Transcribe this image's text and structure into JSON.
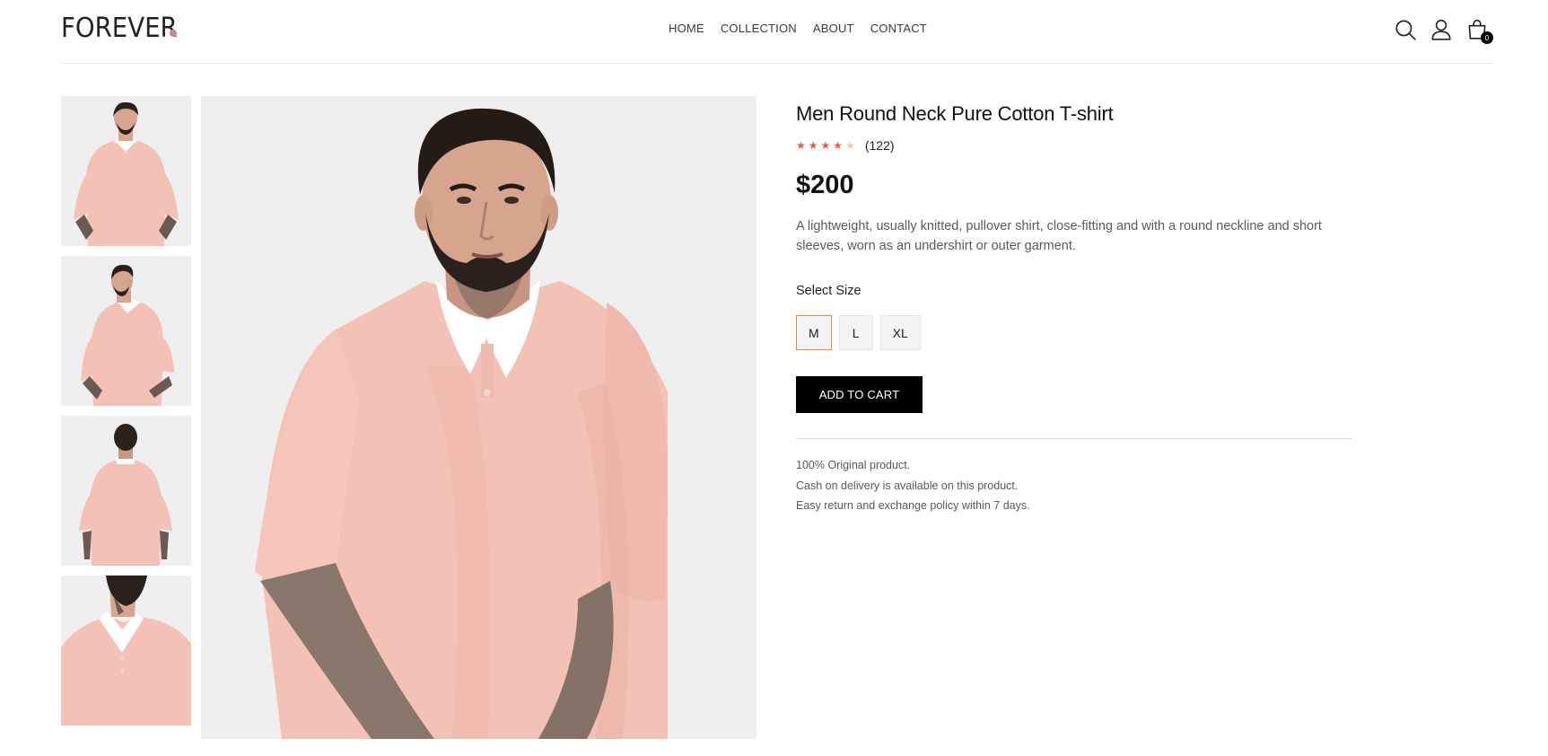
{
  "header": {
    "logo": "FOREVER",
    "nav": [
      "HOME",
      "COLLECTION",
      "ABOUT",
      "CONTACT"
    ],
    "cart_count": "0",
    "icons": [
      "search-icon",
      "profile-icon",
      "cart-icon"
    ]
  },
  "product": {
    "title": "Men Round Neck Pure Cotton T-shirt",
    "rating_stars": 4,
    "rating_max": 5,
    "rating_count": "(122)",
    "price": "$200",
    "description": "A lightweight, usually knitted, pullover shirt, close-fitting and with a round neckline and short sleeves, worn as an undershirt or outer garment.",
    "size_label": "Select Size",
    "sizes": [
      "M",
      "L",
      "XL"
    ],
    "selected_size": "M",
    "add_to_cart": "ADD TO CART",
    "policies": [
      "100% Original product.",
      "Cash on delivery is available on this product.",
      "Easy return and exchange policy within 7 days."
    ]
  },
  "colors": {
    "accent_star": "#f05a3a",
    "selected_border": "#f08a2c",
    "logo_dot": "#c586a5",
    "shirt": "#f4c1b6",
    "image_bg": "#efefef"
  }
}
